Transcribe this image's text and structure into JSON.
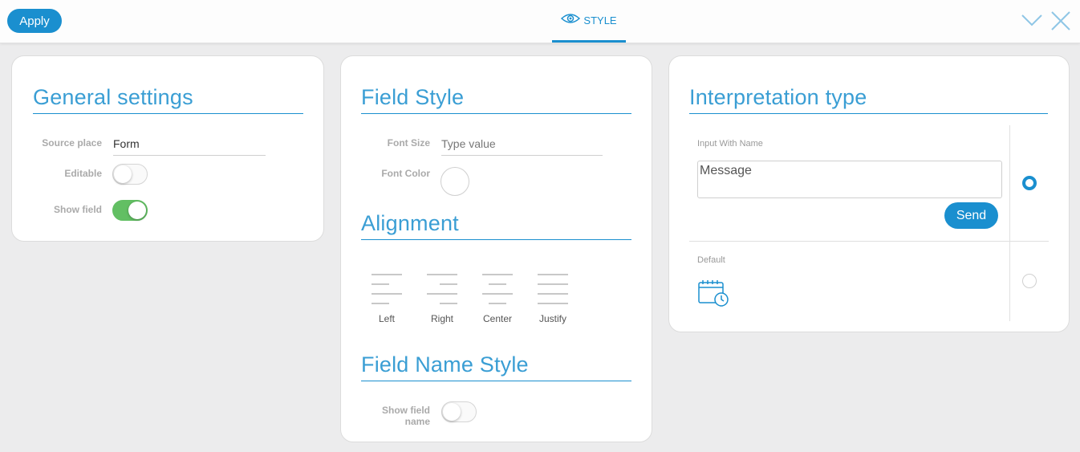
{
  "topbar": {
    "apply_label": "Apply",
    "tab_label": "STYLE",
    "accent_color": "#1a8fcf"
  },
  "general_settings": {
    "title": "General settings",
    "source_place_label": "Source place",
    "source_place_value": "Form",
    "editable_label": "Editable",
    "editable_on": false,
    "show_field_label": "Show field",
    "show_field_on": true
  },
  "field_style": {
    "title": "Field Style",
    "font_size_label": "Font Size",
    "font_size_placeholder": "Type value",
    "font_color_label": "Font Color",
    "alignment_title": "Alignment",
    "alignment_options": [
      "Left",
      "Right",
      "Center",
      "Justify"
    ],
    "field_name_style_title": "Field Name Style",
    "show_field_name_label_line1": "Show field",
    "show_field_name_label_line2": "name",
    "show_field_name_on": false
  },
  "interpretation": {
    "title": "Interpretation type",
    "option1_label": "Input With Name",
    "option1_input_value": "Message",
    "option1_button": "Send",
    "option1_selected": true,
    "option2_label": "Default",
    "option2_icon": "calendar-clock-icon",
    "option2_selected": false
  }
}
